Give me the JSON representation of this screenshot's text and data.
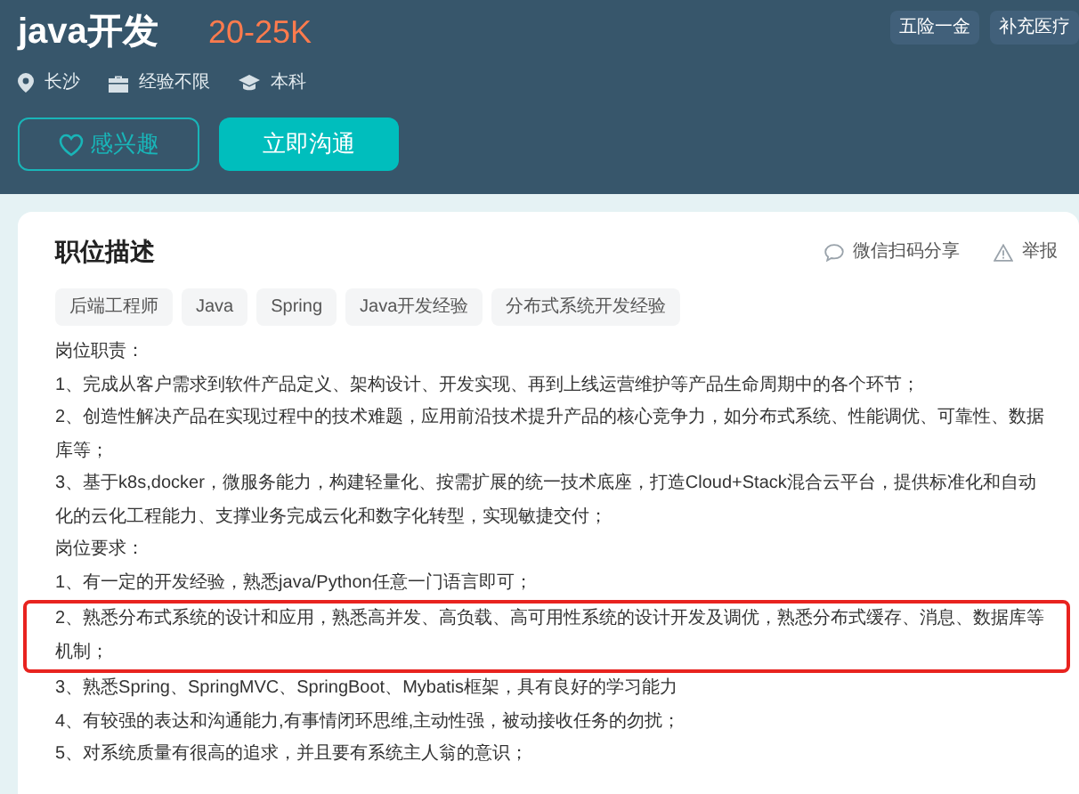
{
  "header": {
    "title": "java开发",
    "salary": "20-25K",
    "benefits": [
      "五险一金",
      "补充医疗"
    ],
    "meta": [
      {
        "kind": "location",
        "text": "长沙"
      },
      {
        "kind": "experience",
        "text": "经验不限"
      },
      {
        "kind": "education",
        "text": "本科"
      }
    ],
    "buttons": [
      {
        "kind": "outline",
        "label": "感兴趣"
      },
      {
        "kind": "primary",
        "label": "立即沟通"
      }
    ]
  },
  "card": {
    "title": "职位描述",
    "actions": [
      {
        "kind": "share",
        "label": "微信扫码分享"
      },
      {
        "kind": "report",
        "label": "举报"
      }
    ],
    "tags": [
      "后端工程师",
      "Java",
      "Spring",
      "Java开发经验",
      "分布式系统开发经验"
    ],
    "sections": [
      {
        "heading": "岗位职责：",
        "items": [
          {
            "text": "1、完成从客户需求到软件产品定义、架构设计、开发实现、再到上线运营维护等产品生命周期中的各个环节；",
            "highlighted": false
          },
          {
            "text": "2、创造性解决产品在实现过程中的技术难题，应用前沿技术提升产品的核心竞争力，如分布式系统、性能调优、可靠性、数据库等；",
            "highlighted": false
          },
          {
            "text": "3、基于k8s,docker，微服务能力，构建轻量化、按需扩展的统一技术底座，打造Cloud+Stack混合云平台，提供标准化和自动化的云化工程能力、支撑业务完成云化和数字化转型，实现敏捷交付；",
            "highlighted": false
          }
        ]
      },
      {
        "heading": "岗位要求：",
        "items": [
          {
            "text": "1、有一定的开发经验，熟悉java/Python任意一门语言即可；",
            "highlighted": false
          },
          {
            "text": "2、熟悉分布式系统的设计和应用，熟悉高并发、高负载、高可用性系统的设计开发及调优，熟悉分布式缓存、消息、数据库等机制；",
            "highlighted": true
          },
          {
            "text": "3、熟悉Spring、SpringMVC、SpringBoot、Mybatis框架，具有良好的学习能力",
            "highlighted": false
          },
          {
            "text": "4、有较强的表达和沟通能力,有事情闭环思维,主动性强，被动接收任务的勿扰；",
            "highlighted": false
          },
          {
            "text": "5、对系统质量有很高的追求，并且要有系统主人翁的意识；",
            "highlighted": false
          }
        ]
      }
    ]
  }
}
